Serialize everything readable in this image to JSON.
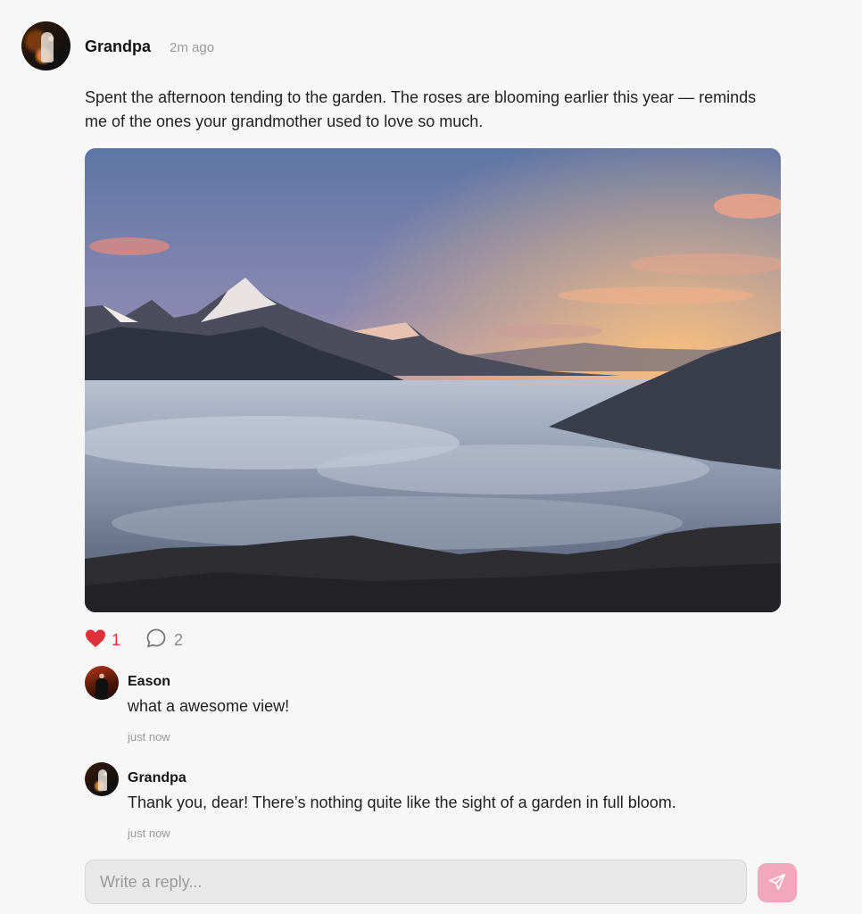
{
  "post": {
    "author": "Grandpa",
    "time": "2m ago",
    "text": "Spent the afternoon tending to the garden. The roses are blooming earlier this year — reminds me of the ones your grandmother used to love so much.",
    "photo_description": "mountain sunset above a sea of clouds",
    "likes": "1",
    "comments_count": "2",
    "liked": true
  },
  "comments": [
    {
      "author": "Eason",
      "text": "what a awesome view!",
      "time": "just now"
    },
    {
      "author": "Grandpa",
      "text": "Thank you, dear! There’s nothing quite like the sight of a garden in full bloom.",
      "time": "just now"
    }
  ],
  "reply": {
    "placeholder": "Write a reply..."
  },
  "colors": {
    "like": "#e0303a",
    "send_button": "#f2a7bc",
    "background": "#f7f7f7"
  },
  "icons": {
    "like": "heart-icon",
    "comment": "speech-bubble-icon",
    "send": "paper-plane-icon"
  }
}
